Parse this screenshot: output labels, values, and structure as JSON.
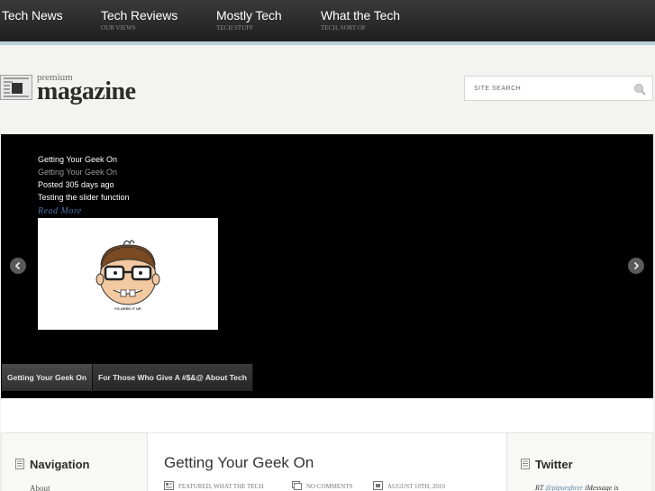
{
  "nav": {
    "items": [
      {
        "title": "Tech News",
        "sub": ""
      },
      {
        "title": "Tech Reviews",
        "sub": "OUR VIEWS"
      },
      {
        "title": "Mostly Tech",
        "sub": "TECH STUFF"
      },
      {
        "title": "What the Tech",
        "sub": "TECH, SORT OF"
      }
    ]
  },
  "logo": {
    "small": "premium",
    "big": "magazine"
  },
  "search": {
    "placeholder": "SITE SEARCH"
  },
  "slider": {
    "title": "Getting Your Geek On",
    "subtitle": "Getting Your Geek On",
    "posted": "Posted 305 days ago",
    "excerpt": "Testing the slider function",
    "read_more": "Read More",
    "image_caption": "YO-GEEK IT UP.",
    "tabs": [
      "Getting Your Geek On",
      "For Those Who Give A #$&@ About Tech"
    ]
  },
  "sidebar_left": {
    "title": "Navigation",
    "link": "About"
  },
  "post": {
    "title": "Getting Your Geek On",
    "categories": "FEATURED, WHAT THE TECH",
    "comments": "NO COMMENTS",
    "date": "AUGUST 10TH, 2010"
  },
  "sidebar_right": {
    "title": "Twitter",
    "tweet_prefix": "RT",
    "tweet_handle": "@pipurghrer",
    "tweet_text": "iMessage is"
  },
  "colors": {
    "nav_bg": "#2a2a2a",
    "nav_accent": "#b8cfd8",
    "slider_bg": "#000000",
    "link": "#4a74a8"
  }
}
